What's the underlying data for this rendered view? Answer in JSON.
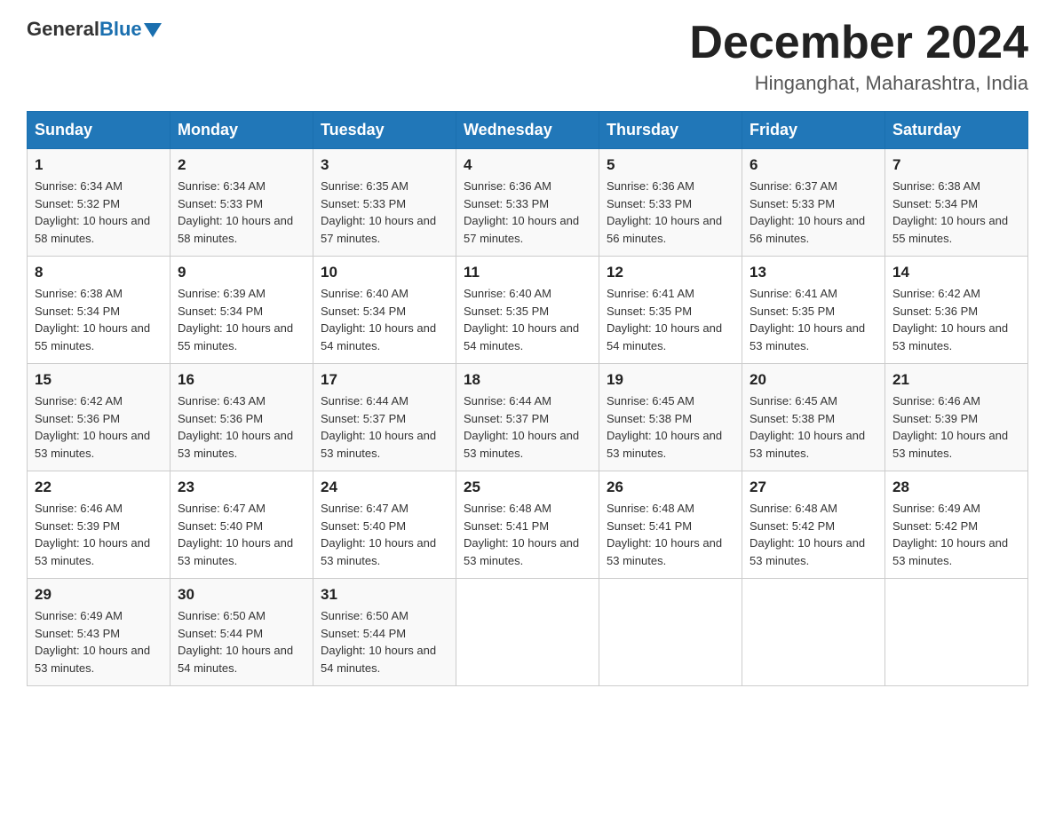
{
  "header": {
    "logo_general": "General",
    "logo_blue": "Blue",
    "month_title": "December 2024",
    "location": "Hinganghat, Maharashtra, India"
  },
  "days_of_week": [
    "Sunday",
    "Monday",
    "Tuesday",
    "Wednesday",
    "Thursday",
    "Friday",
    "Saturday"
  ],
  "weeks": [
    [
      {
        "num": "1",
        "sunrise": "6:34 AM",
        "sunset": "5:32 PM",
        "daylight": "10 hours and 58 minutes."
      },
      {
        "num": "2",
        "sunrise": "6:34 AM",
        "sunset": "5:33 PM",
        "daylight": "10 hours and 58 minutes."
      },
      {
        "num": "3",
        "sunrise": "6:35 AM",
        "sunset": "5:33 PM",
        "daylight": "10 hours and 57 minutes."
      },
      {
        "num": "4",
        "sunrise": "6:36 AM",
        "sunset": "5:33 PM",
        "daylight": "10 hours and 57 minutes."
      },
      {
        "num": "5",
        "sunrise": "6:36 AM",
        "sunset": "5:33 PM",
        "daylight": "10 hours and 56 minutes."
      },
      {
        "num": "6",
        "sunrise": "6:37 AM",
        "sunset": "5:33 PM",
        "daylight": "10 hours and 56 minutes."
      },
      {
        "num": "7",
        "sunrise": "6:38 AM",
        "sunset": "5:34 PM",
        "daylight": "10 hours and 55 minutes."
      }
    ],
    [
      {
        "num": "8",
        "sunrise": "6:38 AM",
        "sunset": "5:34 PM",
        "daylight": "10 hours and 55 minutes."
      },
      {
        "num": "9",
        "sunrise": "6:39 AM",
        "sunset": "5:34 PM",
        "daylight": "10 hours and 55 minutes."
      },
      {
        "num": "10",
        "sunrise": "6:40 AM",
        "sunset": "5:34 PM",
        "daylight": "10 hours and 54 minutes."
      },
      {
        "num": "11",
        "sunrise": "6:40 AM",
        "sunset": "5:35 PM",
        "daylight": "10 hours and 54 minutes."
      },
      {
        "num": "12",
        "sunrise": "6:41 AM",
        "sunset": "5:35 PM",
        "daylight": "10 hours and 54 minutes."
      },
      {
        "num": "13",
        "sunrise": "6:41 AM",
        "sunset": "5:35 PM",
        "daylight": "10 hours and 53 minutes."
      },
      {
        "num": "14",
        "sunrise": "6:42 AM",
        "sunset": "5:36 PM",
        "daylight": "10 hours and 53 minutes."
      }
    ],
    [
      {
        "num": "15",
        "sunrise": "6:42 AM",
        "sunset": "5:36 PM",
        "daylight": "10 hours and 53 minutes."
      },
      {
        "num": "16",
        "sunrise": "6:43 AM",
        "sunset": "5:36 PM",
        "daylight": "10 hours and 53 minutes."
      },
      {
        "num": "17",
        "sunrise": "6:44 AM",
        "sunset": "5:37 PM",
        "daylight": "10 hours and 53 minutes."
      },
      {
        "num": "18",
        "sunrise": "6:44 AM",
        "sunset": "5:37 PM",
        "daylight": "10 hours and 53 minutes."
      },
      {
        "num": "19",
        "sunrise": "6:45 AM",
        "sunset": "5:38 PM",
        "daylight": "10 hours and 53 minutes."
      },
      {
        "num": "20",
        "sunrise": "6:45 AM",
        "sunset": "5:38 PM",
        "daylight": "10 hours and 53 minutes."
      },
      {
        "num": "21",
        "sunrise": "6:46 AM",
        "sunset": "5:39 PM",
        "daylight": "10 hours and 53 minutes."
      }
    ],
    [
      {
        "num": "22",
        "sunrise": "6:46 AM",
        "sunset": "5:39 PM",
        "daylight": "10 hours and 53 minutes."
      },
      {
        "num": "23",
        "sunrise": "6:47 AM",
        "sunset": "5:40 PM",
        "daylight": "10 hours and 53 minutes."
      },
      {
        "num": "24",
        "sunrise": "6:47 AM",
        "sunset": "5:40 PM",
        "daylight": "10 hours and 53 minutes."
      },
      {
        "num": "25",
        "sunrise": "6:48 AM",
        "sunset": "5:41 PM",
        "daylight": "10 hours and 53 minutes."
      },
      {
        "num": "26",
        "sunrise": "6:48 AM",
        "sunset": "5:41 PM",
        "daylight": "10 hours and 53 minutes."
      },
      {
        "num": "27",
        "sunrise": "6:48 AM",
        "sunset": "5:42 PM",
        "daylight": "10 hours and 53 minutes."
      },
      {
        "num": "28",
        "sunrise": "6:49 AM",
        "sunset": "5:42 PM",
        "daylight": "10 hours and 53 minutes."
      }
    ],
    [
      {
        "num": "29",
        "sunrise": "6:49 AM",
        "sunset": "5:43 PM",
        "daylight": "10 hours and 53 minutes."
      },
      {
        "num": "30",
        "sunrise": "6:50 AM",
        "sunset": "5:44 PM",
        "daylight": "10 hours and 54 minutes."
      },
      {
        "num": "31",
        "sunrise": "6:50 AM",
        "sunset": "5:44 PM",
        "daylight": "10 hours and 54 minutes."
      },
      null,
      null,
      null,
      null
    ]
  ]
}
